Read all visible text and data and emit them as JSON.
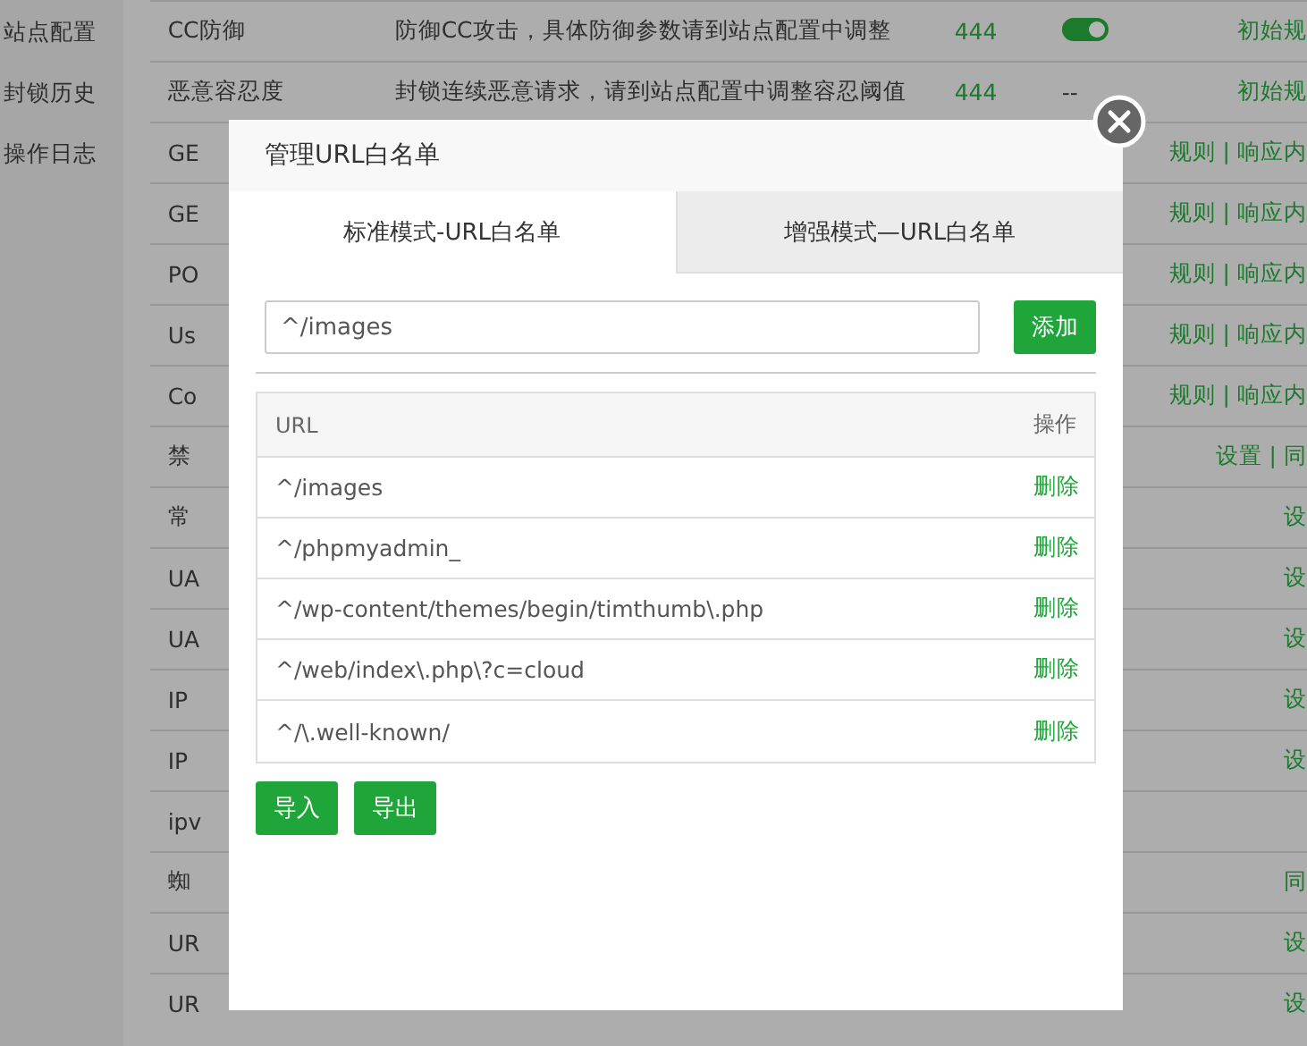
{
  "sidebar": {
    "items": [
      {
        "label": "站点配置"
      },
      {
        "label": "封锁历史"
      },
      {
        "label": "操作日志"
      }
    ]
  },
  "rules": [
    {
      "name": "CC防御",
      "description": "防御CC攻击，具体防御参数请到站点配置中调整",
      "code": "444",
      "kind": "toggle",
      "on": true,
      "actions": "初始规"
    },
    {
      "name": "恶意容忍度",
      "description": "封锁连续恶意请求，请到站点配置中调整容忍阈值",
      "code": "444",
      "kind": "text",
      "status": "--",
      "actions": "初始规"
    },
    {
      "name": "GE",
      "actions": "规则 | 响应内"
    },
    {
      "name": "GE",
      "actions": "规则 | 响应内"
    },
    {
      "name": "PO",
      "actions": "规则 | 响应内"
    },
    {
      "name": "Us",
      "actions": "规则 | 响应内"
    },
    {
      "name": "Co",
      "actions": "规则 | 响应内"
    },
    {
      "name": "禁",
      "actions": "设置 | 同"
    },
    {
      "name": "常",
      "actions": "设"
    },
    {
      "name": "UA",
      "actions": "设"
    },
    {
      "name": "UA",
      "actions": "设"
    },
    {
      "name": "IP",
      "actions": "设"
    },
    {
      "name": "IP",
      "actions": "设"
    },
    {
      "name": "ipv"
    },
    {
      "name": "蜘",
      "actions": "同"
    },
    {
      "name": "UR",
      "actions": "设"
    },
    {
      "name": "UR",
      "actions": "设"
    }
  ],
  "dialog": {
    "title": "管理URL白名单",
    "tabs": [
      {
        "label": "标准模式-URL白名单",
        "selected": true
      },
      {
        "label": "增强模式—URL白名单",
        "selected": false
      }
    ],
    "url_field": {
      "value": "^/images"
    },
    "add_button": "添加",
    "table": {
      "columns": [
        "URL",
        "操作"
      ],
      "rows": [
        {
          "url": "^/images",
          "action": "删除"
        },
        {
          "url": "^/phpmyadmin_",
          "action": "删除"
        },
        {
          "url": "^/wp-content/themes/begin/timthumb\\.php",
          "action": "删除"
        },
        {
          "url": "^/web/index\\.php\\?c=cloud",
          "action": "删除"
        },
        {
          "url": "^/\\.well-known/",
          "action": "删除"
        }
      ]
    },
    "buttons": [
      "导入",
      "导出"
    ]
  }
}
